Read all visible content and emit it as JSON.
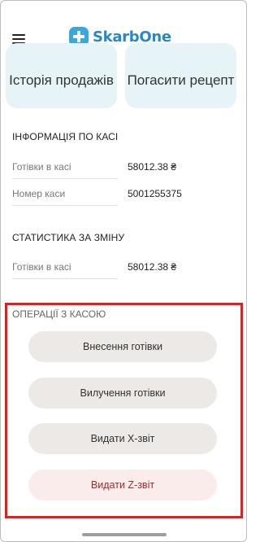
{
  "header": {
    "logo_text": "SkarbOne"
  },
  "tiles": {
    "sales_history": "Історія продажів",
    "repay_receipt": "Погасити рецепт"
  },
  "register_info": {
    "title": "ІНФОРМАЦІЯ ПО КАСІ",
    "rows": [
      {
        "label": "Готівки в касі",
        "value": "58012.38 ₴"
      },
      {
        "label": "Номер каси",
        "value": "5001255375"
      }
    ]
  },
  "shift_stats": {
    "title": "СТАТИСТИКА ЗА ЗМІНУ",
    "rows": [
      {
        "label": "Готівки в касі",
        "value": "58012.38 ₴"
      }
    ]
  },
  "operations": {
    "title": "ОПЕРАЦІЇ З КАСОЮ",
    "buttons": [
      {
        "label": "Внесення готівки"
      },
      {
        "label": "Вилучення готівки"
      },
      {
        "label": "Видати X-звіт"
      },
      {
        "label": "Видати Z-звіт"
      }
    ]
  },
  "colors": {
    "accent": "#2b86c5",
    "highlight_border": "#e01f1f",
    "tile_bg": "#e6f4f8",
    "button_bg": "#ece9e6",
    "danger_bg": "#fbecec",
    "danger_text": "#a12a2a"
  }
}
